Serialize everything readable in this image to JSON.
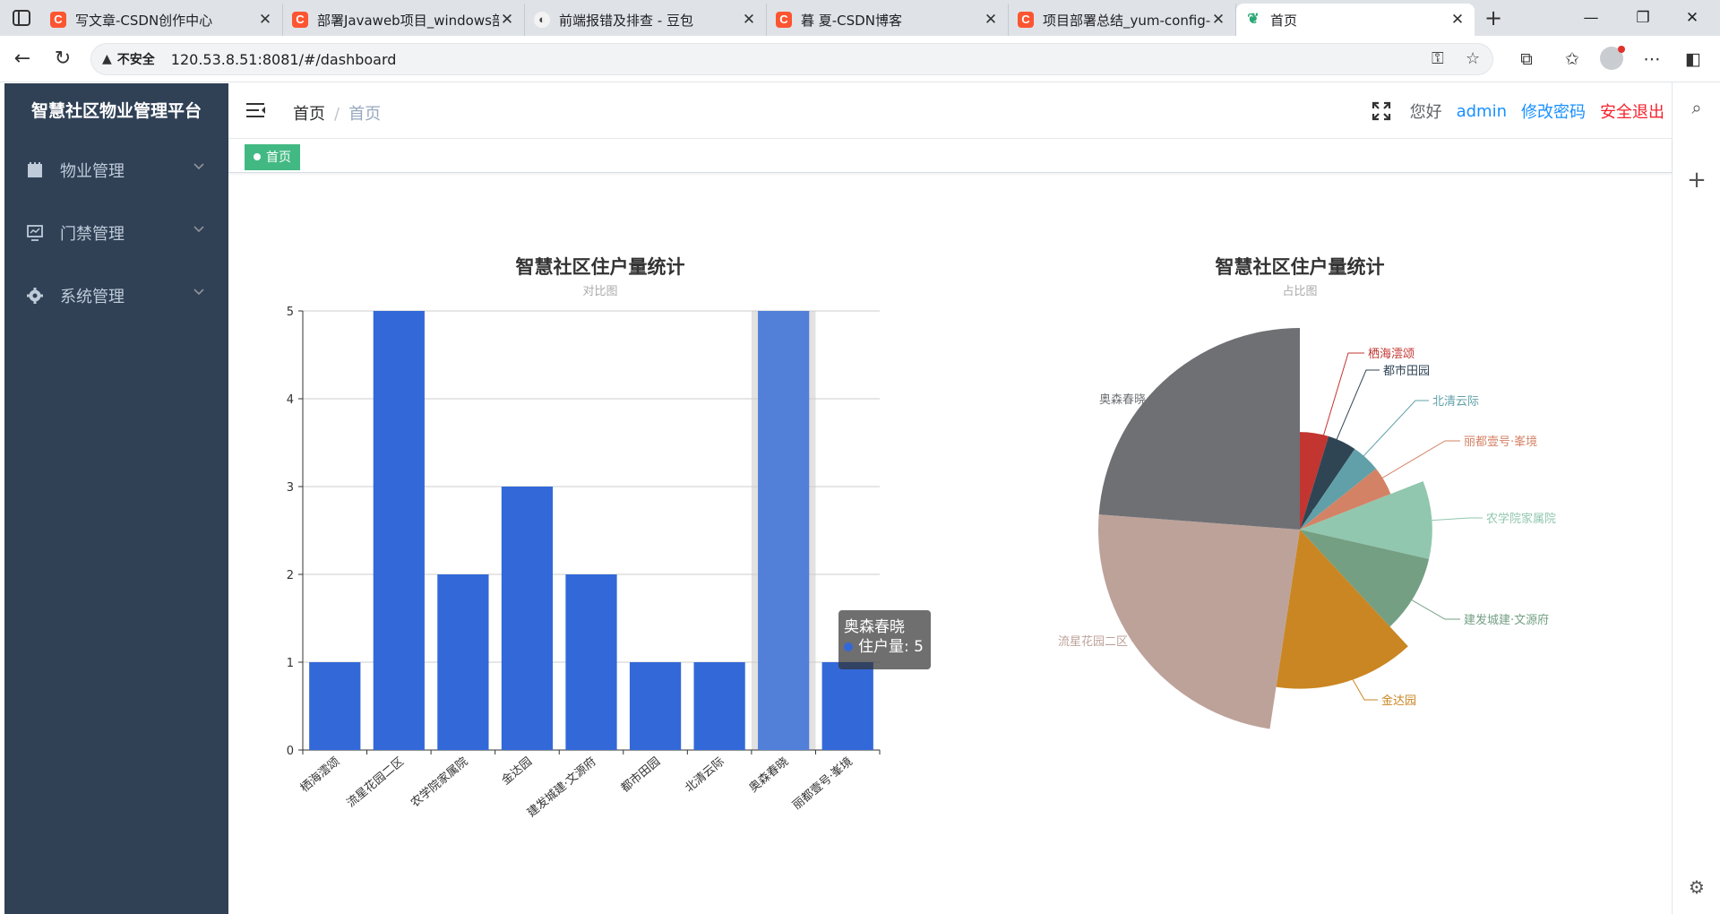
{
  "browser": {
    "tabs": [
      {
        "favicon": "C",
        "title": "写文章-CSDN创作中心"
      },
      {
        "favicon": "C",
        "title": "部署Javaweb项目_windows部"
      },
      {
        "favicon": "doubao",
        "title": "前端报错及排查 - 豆包"
      },
      {
        "favicon": "C",
        "title": "暮 夏-CSDN博客"
      },
      {
        "favicon": "C",
        "title": "项目部署总结_yum-config-m"
      },
      {
        "favicon": "leaf",
        "title": "首页",
        "active": true
      }
    ],
    "security_label": "不安全",
    "url": "120.53.8.51:8081/#/dashboard"
  },
  "app": {
    "title": "智慧社区物业管理平台",
    "menu": [
      {
        "label": "物业管理",
        "icon": "clipboard-icon"
      },
      {
        "label": "门禁管理",
        "icon": "monitor-icon"
      },
      {
        "label": "系统管理",
        "icon": "gear-icon"
      }
    ]
  },
  "navbar": {
    "breadcrumb": [
      "首页",
      "首页"
    ],
    "breadcrumb_separator": "/",
    "greeting": "您好",
    "username": "admin",
    "change_password": "修改密码",
    "logout": "安全退出"
  },
  "tags": [
    {
      "label": "首页",
      "active": true
    }
  ],
  "colors": {
    "sidebar_bg": "#304156",
    "tag_active": "#42b983",
    "link_blue": "#1890ff",
    "logout_red": "#f5222d",
    "bar_blue": "#3368d8"
  },
  "tooltip": {
    "title": "奥森春晓",
    "series": "住户量",
    "value": 5
  },
  "chart_data": [
    {
      "type": "bar",
      "title": "智慧社区住户量统计",
      "subtitle": "对比图",
      "categories": [
        "栖海澐颂",
        "流星花园二区",
        "农学院家属院",
        "金达园",
        "建发城建·文源府",
        "都市田园",
        "北清云际",
        "奥森春晓",
        "丽都壹号·峯境"
      ],
      "series": [
        {
          "name": "住户量",
          "values": [
            1,
            5,
            2,
            3,
            2,
            1,
            1,
            5,
            1
          ]
        }
      ],
      "ylim": [
        0,
        5
      ],
      "yticks": [
        0,
        1,
        2,
        3,
        4,
        5
      ],
      "highlighted_category": "奥森春晓",
      "color": "#3368d8"
    },
    {
      "type": "pie",
      "subtype": "nightingale-area",
      "title": "智慧社区住户量统计",
      "subtitle": "占比图",
      "slices": [
        {
          "name": "栖海澐颂",
          "value": 1,
          "color": "#c23531"
        },
        {
          "name": "都市田园",
          "value": 1,
          "color": "#2f4554"
        },
        {
          "name": "北清云际",
          "value": 1,
          "color": "#61a0a8"
        },
        {
          "name": "丽都壹号·峯境",
          "value": 1,
          "color": "#d48265"
        },
        {
          "name": "农学院家属院",
          "value": 2,
          "color": "#91c7ae"
        },
        {
          "name": "建发城建·文源府",
          "value": 2,
          "color": "#749f83"
        },
        {
          "name": "金达园",
          "value": 3,
          "color": "#ca8622"
        },
        {
          "name": "流星花园二区",
          "value": 5,
          "color": "#bda29a"
        },
        {
          "name": "奥森春晓",
          "value": 5,
          "color": "#6e7074"
        }
      ]
    }
  ]
}
